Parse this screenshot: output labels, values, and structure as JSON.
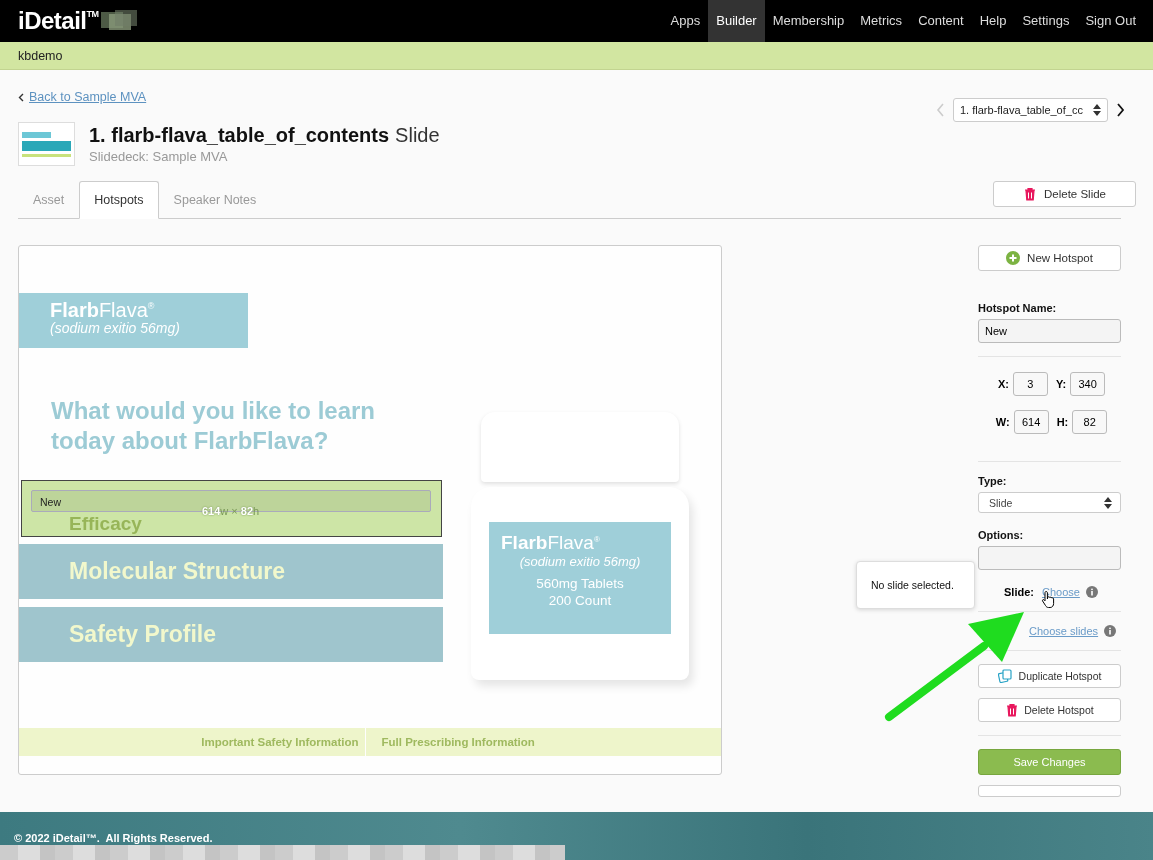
{
  "nav": {
    "logo": "iDetail$^{TM}$",
    "items": [
      {
        "label": "Apps",
        "selected": false
      },
      {
        "label": "Builder",
        "selected": true
      },
      {
        "label": "Membership",
        "selected": false
      },
      {
        "label": "Metrics",
        "selected": false
      },
      {
        "label": "Content",
        "selected": false
      },
      {
        "label": "Help",
        "selected": false
      },
      {
        "label": "Settings",
        "selected": false
      },
      {
        "label": "Sign Out",
        "selected": false
      }
    ]
  },
  "account": "kbdemo",
  "back_link": "Back to Sample MVA",
  "slide_picker": {
    "value": "1. flarb-flava_table_of_cc",
    "prev_disabled": true
  },
  "title": {
    "number": "1.",
    "name": "flarb-flava_table_of_contents",
    "suffix": "Slide",
    "subtitle": "Slidedeck: Sample MVA"
  },
  "tabs": [
    {
      "label": "Asset",
      "selected": false
    },
    {
      "label": "Hotspots",
      "selected": true
    },
    {
      "label": "Speaker Notes",
      "selected": false
    }
  ],
  "delete_slide": "Delete Slide",
  "slide": {
    "brand": "**Flarb**Flava$^{®}$",
    "brand_sub": "(sodium exitio 56mg)",
    "question": "What would you like to learn today about FlarbFlava?",
    "menu": [
      {
        "label": "Efficacy",
        "kind": "under-hotspot"
      },
      {
        "label": "Molecular Structure",
        "kind": "bar"
      },
      {
        "label": "Safety Profile",
        "kind": "bar"
      }
    ],
    "bottle_brand": "**Flarb**Flava$^{®}$",
    "bottle_sub": "(sodium exitio 56mg)",
    "bottle_lines": [
      "560mg Tablets",
      "200 Count"
    ],
    "footer_links": [
      "Important Safety Information",
      "Full Prescribing Information"
    ]
  },
  "hotspot": {
    "name": "New",
    "dims": "**614**w × **82**h"
  },
  "panel": {
    "new_hotspot": "New Hotspot",
    "name_label": "Hotspot Name:",
    "name_value": "New",
    "coords": [
      [
        {
          "label": "X:",
          "value": "3"
        },
        {
          "label": "Y:",
          "value": "340"
        }
      ],
      [
        {
          "label": "W:",
          "value": "614"
        },
        {
          "label": "H:",
          "value": "82"
        }
      ]
    ],
    "type_label": "Type:",
    "type_value": "Slide",
    "options_label": "Options:",
    "slide_label": "Slide:",
    "slide_link": "Choose",
    "slides_link": "Choose slides",
    "duplicate": "Duplicate Hotspot",
    "delete": "Delete Hotspot",
    "save": "Save Changes"
  },
  "tooltip": "No slide selected.",
  "footer": "© 2022 iDetail™.  All Rights Reserved."
}
